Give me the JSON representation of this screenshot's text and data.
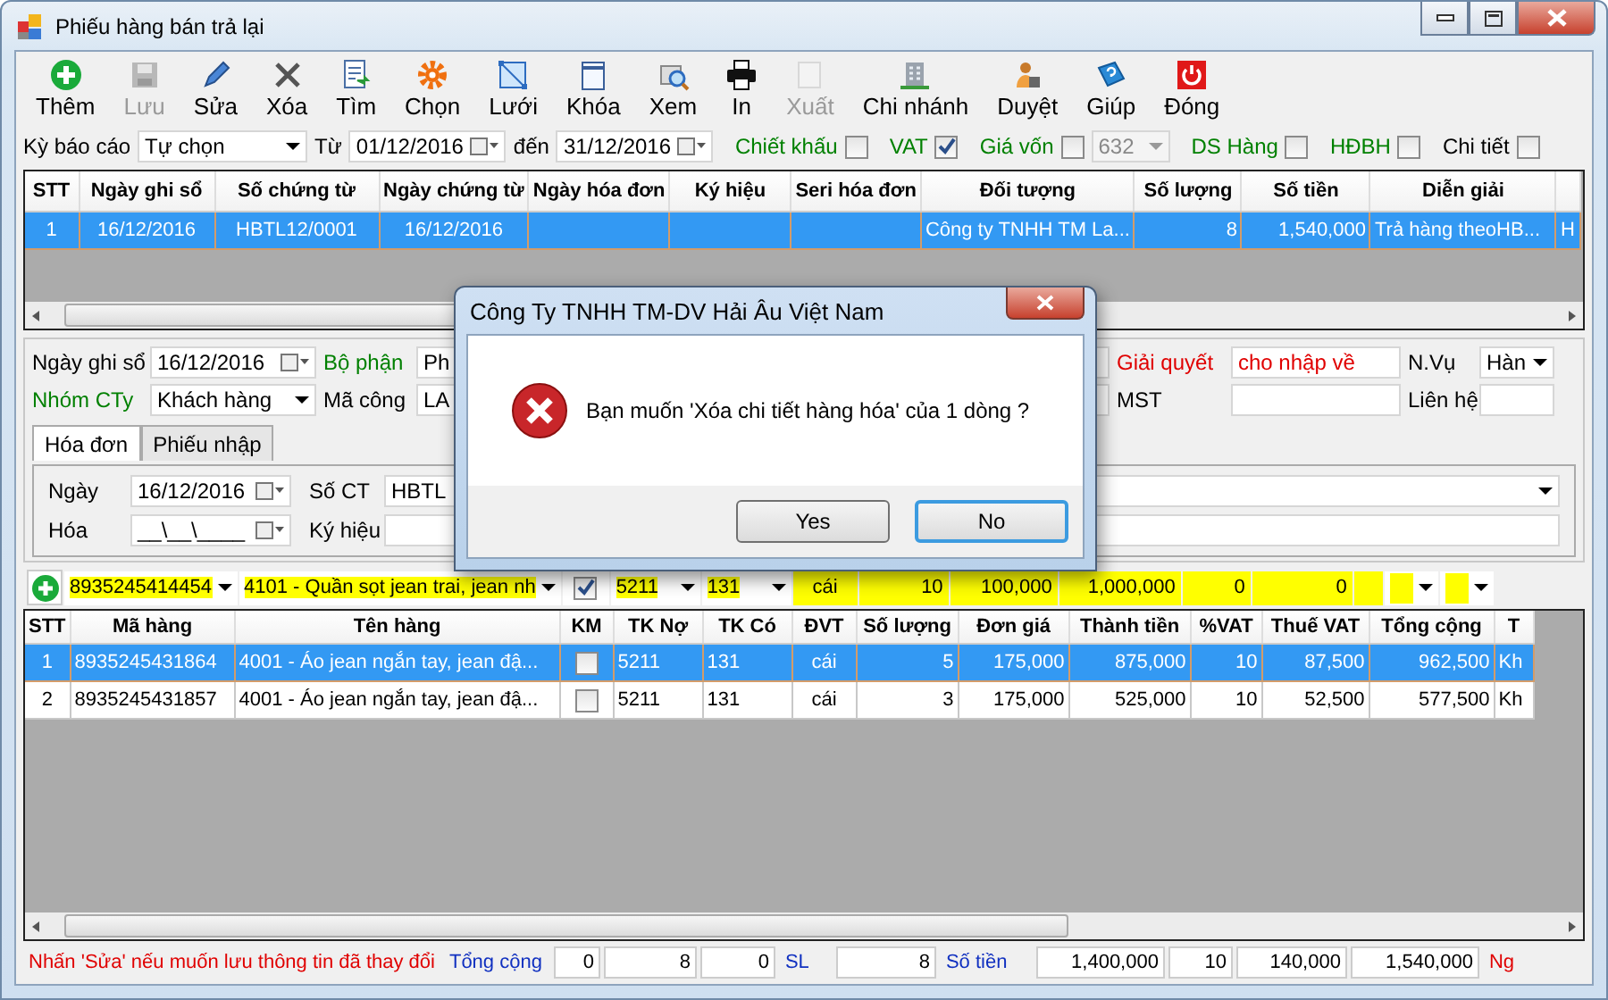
{
  "window": {
    "title": "Phiếu hàng bán trả lại"
  },
  "toolbar": [
    {
      "label": "Thêm",
      "kind": "add",
      "disabled": false
    },
    {
      "label": "Lưu",
      "kind": "save",
      "disabled": true
    },
    {
      "label": "Sửa",
      "kind": "edit",
      "disabled": false
    },
    {
      "label": "Xóa",
      "kind": "delete",
      "disabled": false
    },
    {
      "label": "Tìm",
      "kind": "find",
      "disabled": false
    },
    {
      "label": "Chọn",
      "kind": "gear",
      "disabled": false
    },
    {
      "label": "Lưới",
      "kind": "grid",
      "disabled": false
    },
    {
      "label": "Khóa",
      "kind": "lock",
      "disabled": false
    },
    {
      "label": "Xem",
      "kind": "view",
      "disabled": false
    },
    {
      "label": "In",
      "kind": "print",
      "disabled": false
    },
    {
      "label": "Xuất",
      "kind": "export",
      "disabled": true
    },
    {
      "label": "Chi nhánh",
      "kind": "branch",
      "disabled": false
    },
    {
      "label": "Duyệt",
      "kind": "approve",
      "disabled": false
    },
    {
      "label": "Giúp",
      "kind": "help",
      "disabled": false
    },
    {
      "label": "Đóng",
      "kind": "power",
      "disabled": false
    }
  ],
  "filter": {
    "period_label": "Kỳ báo cáo",
    "period": "Tự chọn",
    "from_label": "Từ",
    "from": "01/12/2016",
    "to_label": "đến",
    "to": "31/12/2016",
    "options": [
      {
        "label": "Chiết khấu",
        "checked": false,
        "color": "#008000"
      },
      {
        "label": "VAT",
        "checked": true,
        "color": "#008000"
      },
      {
        "label": "Giá vốn",
        "checked": false,
        "color": "#008000"
      },
      {
        "label": "DS Hàng",
        "checked": false,
        "color": "#008000"
      },
      {
        "label": "HĐBH",
        "checked": false,
        "color": "#008000"
      },
      {
        "label": "Chi tiết",
        "checked": false,
        "color": "#000000"
      }
    ],
    "account": "632"
  },
  "voucher_grid": {
    "columns": [
      "STT",
      "Ngày ghi sổ",
      "Số chứng từ",
      "Ngày chứng từ",
      "Ngày hóa đơn",
      "Ký hiệu",
      "Seri hóa đơn",
      "Đối tượng",
      "Số lượng",
      "Số tiền",
      "Diễn giải"
    ],
    "rows": [
      {
        "selected": true,
        "cells": [
          "1",
          "16/12/2016",
          "HBTL12/0001",
          "16/12/2016",
          "",
          "",
          "",
          "Công ty TNHH TM La...",
          "8",
          "1,540,000",
          "Trả hàng theoHB...",
          "H"
        ]
      }
    ]
  },
  "form": {
    "rows": [
      [
        {
          "label": "Ngày ghi sổ",
          "value": "16/12/2016",
          "kind": "date",
          "color": "#000000"
        },
        {
          "label": "Bộ phận",
          "value": "Ph",
          "kind": "text",
          "color": "#008000"
        },
        {
          "label": "Giải quyết",
          "value": "cho nhập về",
          "kind": "text",
          "color": "#e00000"
        },
        {
          "label": "N.Vụ",
          "value": "Hàn",
          "kind": "combo",
          "color": "#000000"
        }
      ],
      [
        {
          "label": "Nhóm CTy",
          "value": "Khách hàng",
          "kind": "combo",
          "color": "#008000"
        },
        {
          "label": "Mã công",
          "value": "LA",
          "kind": "text",
          "color": "#000000"
        },
        {
          "label": "MST",
          "kind": "text",
          "color": "#000000"
        },
        {
          "label": "Liên hệ",
          "kind": "text",
          "color": "#000000"
        }
      ]
    ]
  },
  "tabs": [
    {
      "label": "Hóa đơn",
      "selected": true
    },
    {
      "label": "Phiếu nhập",
      "selected": false
    }
  ],
  "invoice": {
    "rows": [
      [
        {
          "label": "Ngày",
          "value": "16/12/2016",
          "kind": "date"
        },
        {
          "label": "Số CT",
          "value": "HBTL",
          "kind": "combo"
        }
      ],
      [
        {
          "label": "Hóa",
          "value": "__\\__\\____",
          "kind": "date"
        },
        {
          "label": "Ký hiệu",
          "kind": "text"
        }
      ]
    ]
  },
  "entry": {
    "code": "8935245414454",
    "name": "4101 - Quần sọt jean trai, jean nh",
    "promo": true,
    "debit": "5211",
    "credit": "131",
    "unit": "cái",
    "qty": "10",
    "price": "100,000",
    "amount": "1,000,000",
    "vat": "0",
    "tax": "0"
  },
  "detail_grid": {
    "columns": [
      "STT",
      "Mã hàng",
      "Tên hàng",
      "KM",
      "TK Nợ",
      "TK Có",
      "ĐVT",
      "Số lượng",
      "Đơn giá",
      "Thành tiền",
      "%VAT",
      "Thuế VAT",
      "Tổng cộng",
      "T"
    ],
    "rows": [
      {
        "selected": true,
        "promo": false,
        "cells": [
          "1",
          "8935245431864",
          "4001 - Áo jean ngắn tay, jean đậ...",
          "",
          "5211",
          "131",
          "cái",
          "5",
          "175,000",
          "875,000",
          "10",
          "87,500",
          "962,500",
          "Kh"
        ]
      },
      {
        "selected": false,
        "promo": false,
        "cells": [
          "2",
          "8935245431857",
          "4001 - Áo jean ngắn tay, jean đậ...",
          "",
          "5211",
          "131",
          "cái",
          "3",
          "175,000",
          "525,000",
          "10",
          "52,500",
          "577,500",
          "Kh"
        ]
      }
    ]
  },
  "status_bar": [
    {
      "text": "Nhấn 'Sửa' nếu muốn lưu thông tin đã thay đổi",
      "kind": "note"
    },
    {
      "text": "Tổng cộng",
      "kind": "label"
    },
    {
      "text": "0",
      "kind": "value"
    },
    {
      "text": "8",
      "kind": "value"
    },
    {
      "text": "0",
      "kind": "value"
    },
    {
      "text": "SL",
      "kind": "label"
    },
    {
      "text": "8",
      "kind": "value"
    },
    {
      "text": "Số tiền",
      "kind": "label"
    },
    {
      "text": "1,400,000",
      "kind": "value"
    },
    {
      "text": "10",
      "kind": "value"
    },
    {
      "text": "140,000",
      "kind": "value"
    },
    {
      "text": "1,540,000",
      "kind": "value"
    },
    {
      "text": "Ng",
      "kind": "note"
    }
  ],
  "dialog": {
    "title": "Công Ty TNHH TM-DV Hải Âu Việt Nam",
    "kind": "error",
    "message": "Bạn muốn 'Xóa chi tiết hàng hóa' của 1 dòng ?",
    "buttons": [
      {
        "label": "Yes",
        "default": false
      },
      {
        "label": "No",
        "default": true
      }
    ]
  }
}
